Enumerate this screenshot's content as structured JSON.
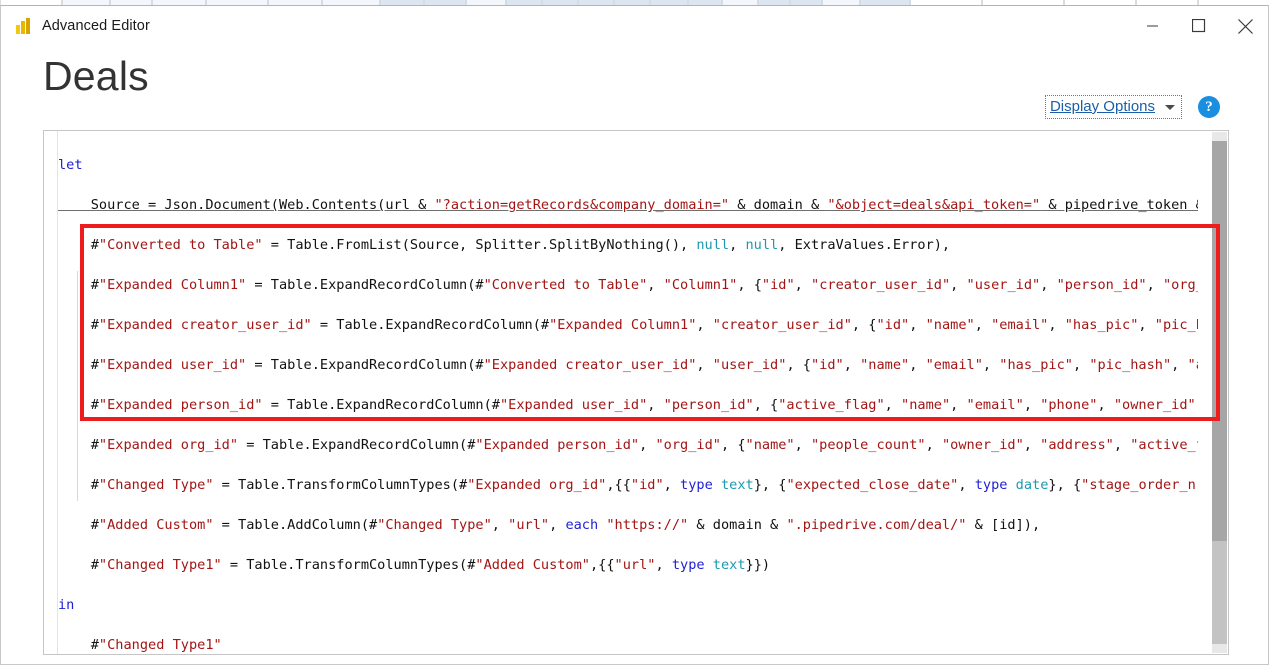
{
  "window": {
    "title": "Advanced Editor",
    "icon": "power-bi-icon",
    "buttons": {
      "minimize": "minimize-icon",
      "maximize": "maximize-icon",
      "close": "close-icon"
    }
  },
  "header": {
    "page_title": "Deals",
    "display_options_label": "Display Options",
    "display_options_caret": "chevron-down-icon",
    "help_label": "?"
  },
  "editor": {
    "language": "M (Power Query)",
    "lines": [
      "let",
      "    Source = Json.Document(Web.Contents(url & \"?action=getRecords&company_domain=\" & domain & \"&object=deals&api_token=\" & pipedrive_token &",
      "    #\"Converted to Table\" = Table.FromList(Source, Splitter.SplitByNothing(), null, null, ExtraValues.Error),",
      "    #\"Expanded Column1\" = Table.ExpandRecordColumn(#\"Converted to Table\", \"Column1\", {\"id\", \"creator_user_id\", \"user_id\", \"person_id\", \"org_i",
      "    #\"Expanded creator_user_id\" = Table.ExpandRecordColumn(#\"Expanded Column1\", \"creator_user_id\", {\"id\", \"name\", \"email\", \"has_pic\", \"pic_ha",
      "    #\"Expanded user_id\" = Table.ExpandRecordColumn(#\"Expanded creator_user_id\", \"user_id\", {\"id\", \"name\", \"email\", \"has_pic\", \"pic_hash\", \"ac",
      "    #\"Expanded person_id\" = Table.ExpandRecordColumn(#\"Expanded user_id\", \"person_id\", {\"active_flag\", \"name\", \"email\", \"phone\", \"owner_id\",",
      "    #\"Expanded org_id\" = Table.ExpandRecordColumn(#\"Expanded person_id\", \"org_id\", {\"name\", \"people_count\", \"owner_id\", \"address\", \"active_fl",
      "    #\"Changed Type\" = Table.TransformColumnTypes(#\"Expanded org_id\",{{\"id\", type text}, {\"expected_close_date\", type date}, {\"stage_order_n\"",
      "    #\"Added Custom\" = Table.AddColumn(#\"Changed Type\", \"url\", each \"https://\" & domain & \".pipedrive.com/deal/\" & [id]),",
      "    #\"Changed Type1\" = Table.TransformColumnTypes(#\"Added Custom\",{{\"url\", type text}})",
      "in",
      "    #\"Changed Type1\""
    ],
    "keywords": [
      "let",
      "in",
      "each",
      "type"
    ],
    "types": [
      "text",
      "date",
      "null"
    ],
    "scrollbar": {
      "vertical": "vertical-scrollbar",
      "up_arrow": "scroll-up-arrow",
      "down_arrow": "scroll-down-arrow"
    }
  },
  "annotation": {
    "type": "red-rectangle-highlight",
    "color": "#ee1c1c",
    "covers_lines": "#\"Converted to Table\" through #\"Changed Type1\""
  }
}
